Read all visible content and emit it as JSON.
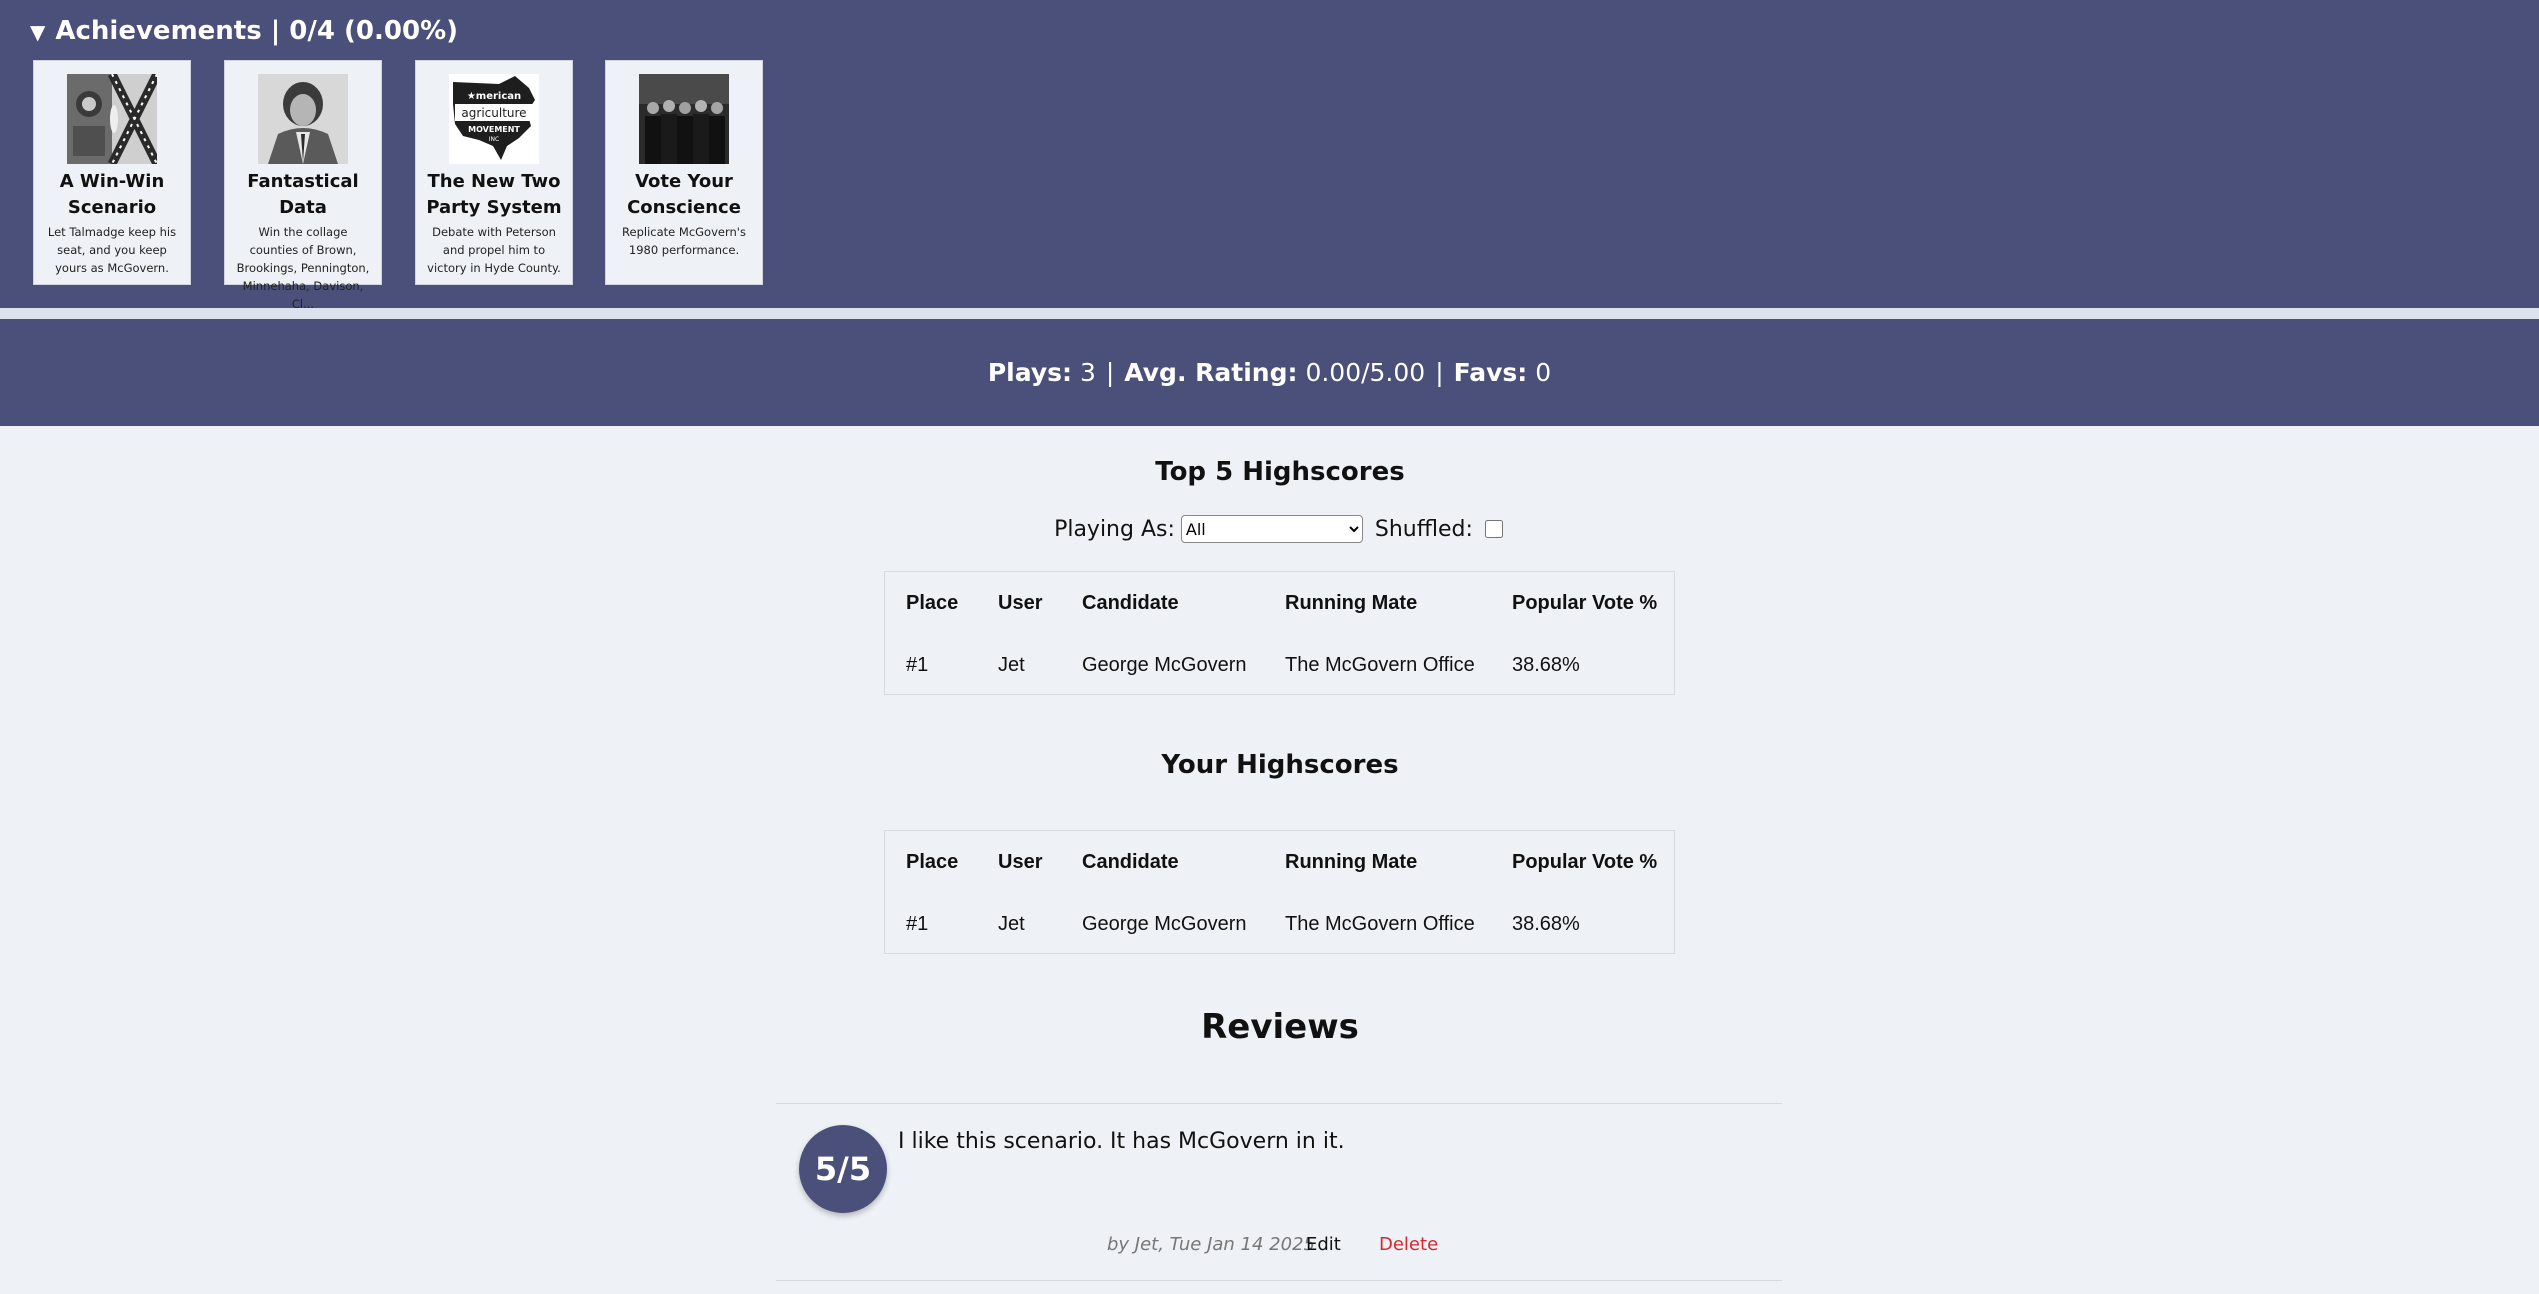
{
  "achievements": {
    "header": "Achievements | 0/4 (0.00%)",
    "toggle_icon": "triangle-down",
    "cards": [
      {
        "title": "A Win-Win Scenario",
        "desc": "Let Talmadge keep his seat, and you keep yours as McGovern.",
        "image": "flags-and-seal-photo"
      },
      {
        "title": "Fantastical Data",
        "desc": "Win the collage counties of Brown, Brookings, Pennington, Minnehaha, Davison, Cl...",
        "image": "man-in-suit-photo"
      },
      {
        "title": "The New Two Party System",
        "desc": "Debate with Peterson and propel him to victory in Hyde County.",
        "image": "american-agriculture-movement-logo"
      },
      {
        "title": "Vote Your Conscience",
        "desc": "Replicate McGovern's 1980 performance.",
        "image": "group-of-men-photo"
      }
    ],
    "logo_text": [
      "merican",
      "agriculture",
      "MOVEMENT",
      "INC"
    ]
  },
  "stats": {
    "plays_label": "Plays:",
    "plays_value": "3",
    "rating_label": "Avg. Rating:",
    "rating_value": "0.00/5.00",
    "favs_label": "Favs:",
    "favs_value": "0",
    "separator": "|"
  },
  "top_highscores": {
    "title": "Top 5 Highscores",
    "headers": [
      "Place",
      "User",
      "Candidate",
      "Running Mate",
      "Popular Vote %"
    ],
    "rows": [
      [
        "#1",
        "Jet",
        "George McGovern",
        "The McGovern Office",
        "38.68%"
      ]
    ]
  },
  "filters": {
    "playing_as_label": "Playing As:",
    "playing_as_value": "All",
    "shuffled_label": "Shuffled:",
    "shuffled_checked": false
  },
  "your_highscores": {
    "title": "Your Highscores",
    "headers": [
      "Place",
      "User",
      "Candidate",
      "Running Mate",
      "Popular Vote %"
    ],
    "rows": [
      [
        "#1",
        "Jet",
        "George McGovern",
        "The McGovern Office",
        "38.68%"
      ]
    ]
  },
  "reviews": {
    "title": "Reviews",
    "items": [
      {
        "rating": "5/5",
        "text": "I like this scenario. It has McGovern in it.",
        "meta": "by Jet, Tue Jan 14 2025",
        "edit_label": "Edit",
        "delete_label": "Delete"
      }
    ]
  },
  "colors": {
    "panel": "#4a5079",
    "background": "#eef2f7",
    "delete": "#d9262a"
  }
}
